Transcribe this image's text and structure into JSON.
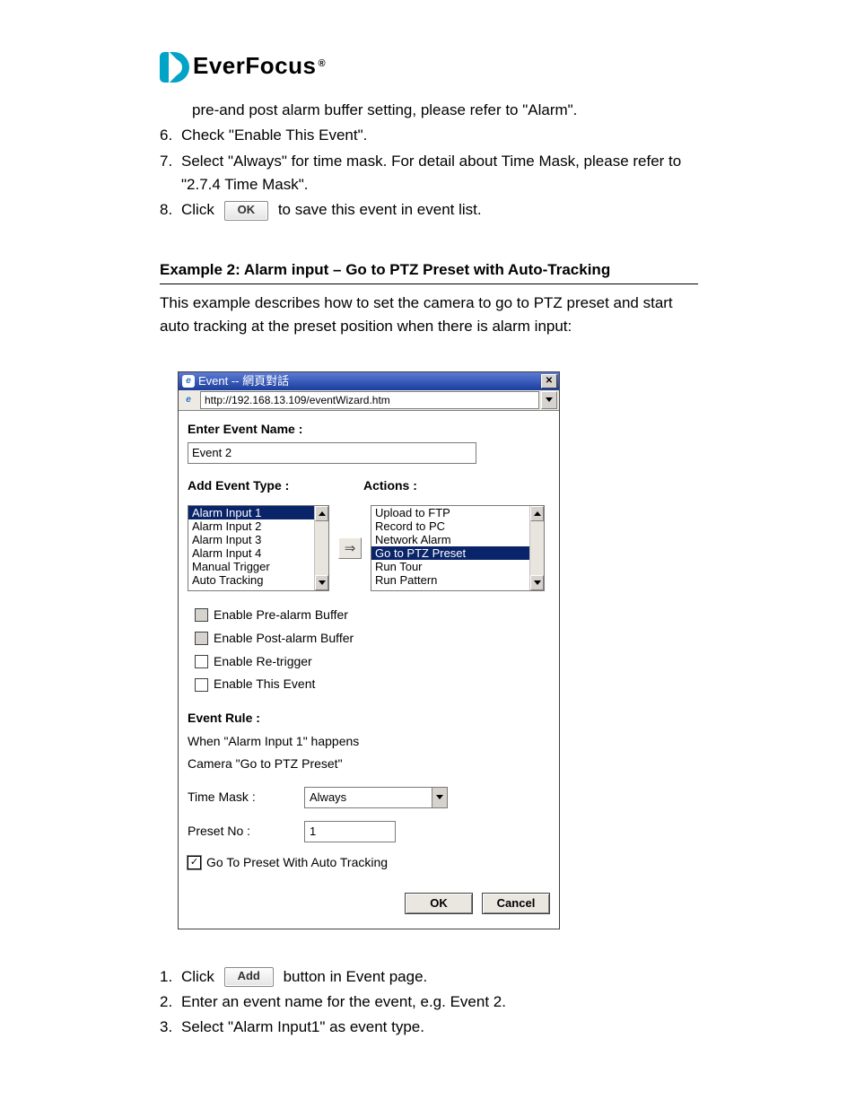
{
  "brand": {
    "name": "EverFocus",
    "trademark": "®"
  },
  "top_paragraphs": {
    "line_pre": "pre-and post alarm buffer setting, please refer to \"Alarm\".",
    "s6_no": "6.",
    "s6": "Check \"Enable This Event\".",
    "s7_no": "7.",
    "s7": "Select \"Always\" for time mask. For detail about Time Mask, please refer to \"2.7.4 Time Mask\".",
    "s8_no": "8.",
    "s8_a": "Click",
    "s8_btn": "OK",
    "s8_b": "to save this event in event list."
  },
  "example2": {
    "heading": "Example 2: Alarm input – Go to PTZ Preset with Auto-Tracking",
    "desc": "This example describes how to set the camera to go to PTZ preset and start auto tracking at the preset position when there is alarm input:"
  },
  "dialog": {
    "title": "Event -- 網頁對話",
    "url": "http://192.168.13.109/eventWizard.htm",
    "enter_label": "Enter Event Name :",
    "event_name": "Event 2",
    "add_type_label": "Add Event Type :",
    "actions_label": "Actions :",
    "event_types": [
      "Alarm Input 1",
      "Alarm Input 2",
      "Alarm Input 3",
      "Alarm Input 4",
      "Manual Trigger",
      "Auto Tracking"
    ],
    "event_types_sel": 0,
    "actions": [
      "Upload to FTP",
      "Record to PC",
      "Network Alarm",
      "Go to PTZ Preset",
      "Run Tour",
      "Run Pattern"
    ],
    "actions_sel": 3,
    "arrow": "⇒",
    "chk_prealarm": "Enable Pre-alarm Buffer",
    "chk_postalarm": "Enable Post-alarm Buffer",
    "chk_retrigger": "Enable Re-trigger",
    "chk_thisevent": "Enable This Event",
    "rule_label": "Event Rule :",
    "rule1": "When \"Alarm Input 1\" happens",
    "rule2": "Camera \"Go to PTZ Preset\"",
    "time_mask_label": "Time Mask :",
    "time_mask_value": "Always",
    "preset_label": "Preset No :",
    "preset_value": "1",
    "chk_auto_track": "Go To Preset With Auto Tracking",
    "ok": "OK",
    "cancel": "Cancel",
    "close_glyph": "✕",
    "check_glyph": "✓"
  },
  "bottom_steps": {
    "s1_no": "1.",
    "s1_a": "Click",
    "s1_btn": "Add",
    "s1_b": "button in Event page.",
    "s2_no": "2.",
    "s2": "Enter an event name for the event, e.g. Event 2.",
    "s3_no": "3.",
    "s3": "Select \"Alarm Input1\" as event type."
  }
}
